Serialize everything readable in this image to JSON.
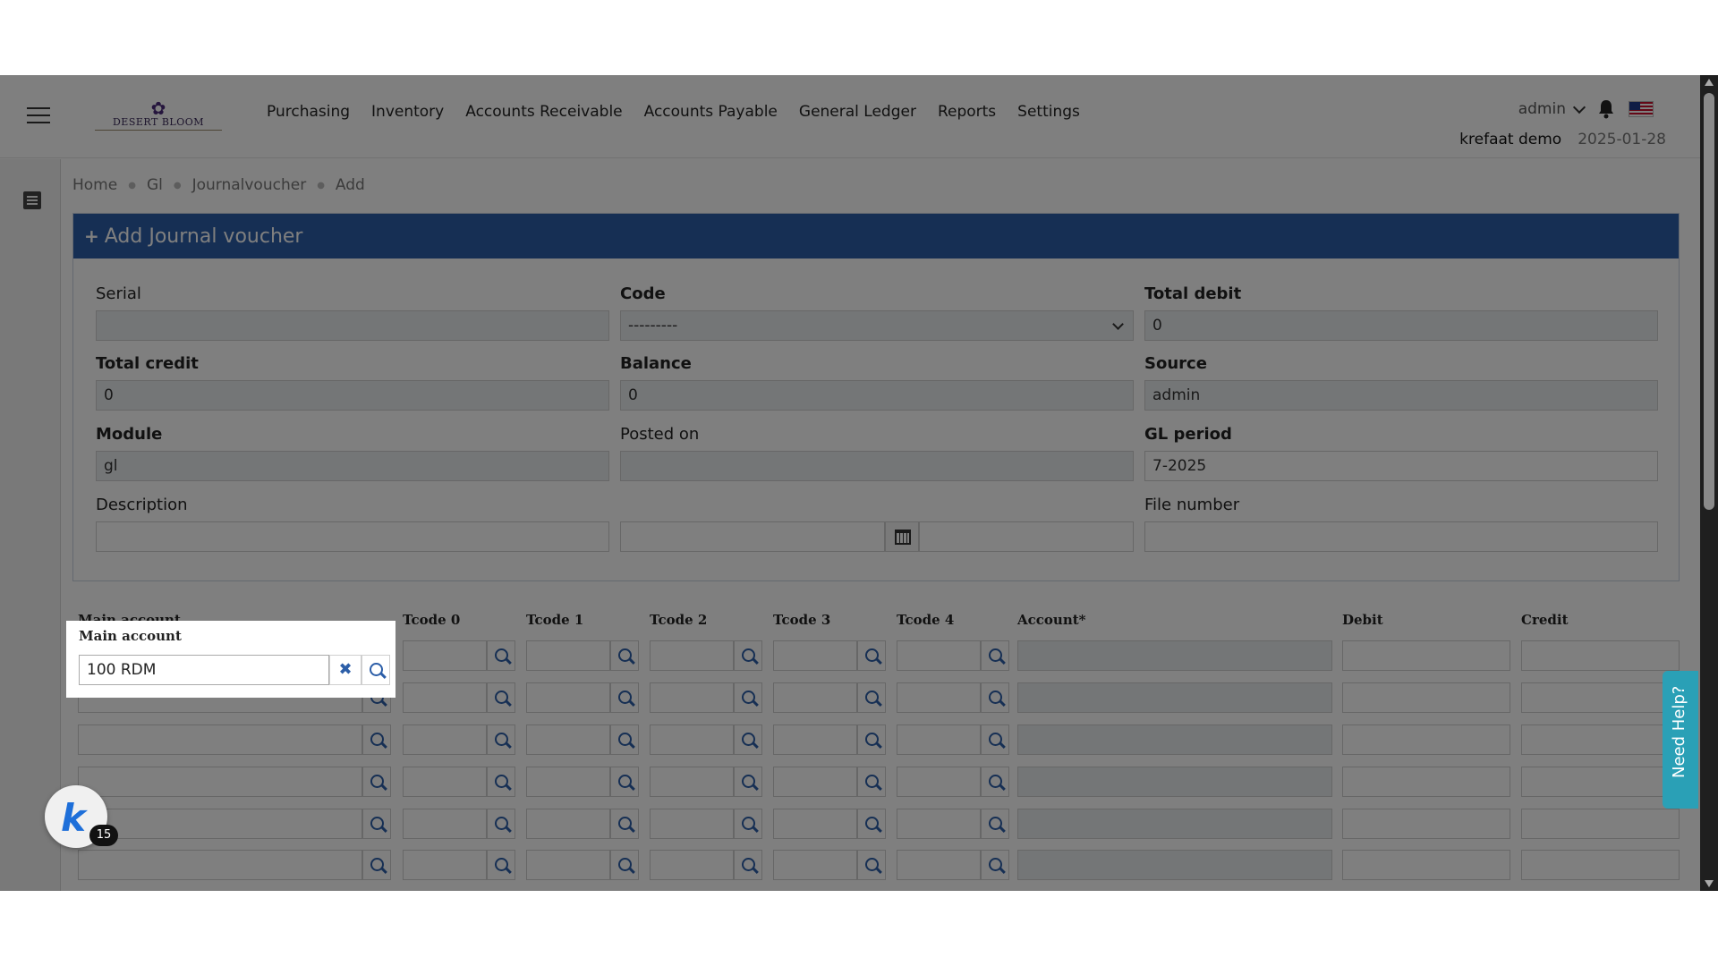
{
  "nav": {
    "brand": "DESERT BLOOM",
    "menu": [
      "Purchasing",
      "Inventory",
      "Accounts Receivable",
      "Accounts Payable",
      "General Ledger",
      "Reports",
      "Settings"
    ],
    "user": "admin",
    "company": "krefaat demo",
    "date": "2025-01-28"
  },
  "breadcrumb": [
    "Home",
    "Gl",
    "Journalvoucher",
    "Add"
  ],
  "card": {
    "title": "Add Journal voucher",
    "fields": {
      "serial": {
        "label": "Serial",
        "value": ""
      },
      "code": {
        "label": "Code",
        "value": "---------"
      },
      "total_debit": {
        "label": "Total debit",
        "value": "0"
      },
      "total_credit": {
        "label": "Total credit",
        "value": "0"
      },
      "balance": {
        "label": "Balance",
        "value": "0"
      },
      "source": {
        "label": "Source",
        "value": "admin"
      },
      "module": {
        "label": "Module",
        "value": "gl"
      },
      "posted_on": {
        "label": "Posted on",
        "value": ""
      },
      "gl_period": {
        "label": "GL period",
        "value": "7-2025"
      },
      "description": {
        "label": "Description",
        "value": ""
      },
      "file_number": {
        "label": "File number",
        "value": ""
      }
    }
  },
  "lines": {
    "headers": {
      "main_account": "Main account",
      "tcode0": "Tcode 0",
      "tcode1": "Tcode 1",
      "tcode2": "Tcode 2",
      "tcode3": "Tcode 3",
      "tcode4": "Tcode 4",
      "account": "Account*",
      "debit": "Debit",
      "credit": "Credit"
    },
    "first_main_account": "100 RDM",
    "clear_glyph": "✖"
  },
  "help": {
    "label": "Need Help?"
  },
  "badge": {
    "letter": "k",
    "count": "15"
  }
}
